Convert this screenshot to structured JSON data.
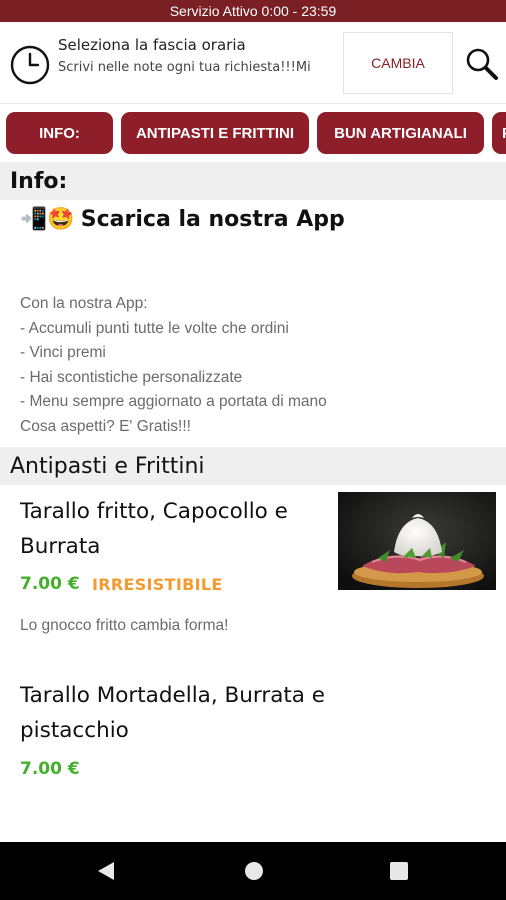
{
  "status_bar": {
    "text": "Servizio Attivo  0:00 - 23:59"
  },
  "timeslot": {
    "title": "Seleziona la fascia oraria",
    "subtitle": "Scrivi nelle note ogni tua richiesta!!!Mi",
    "change_label": "CAMBIA"
  },
  "tabs": [
    {
      "label": "INFO:"
    },
    {
      "label": "ANTIPASTI E FRITTINI"
    },
    {
      "label": "BUN  ARTIGIANALI"
    },
    {
      "label": "P"
    }
  ],
  "info": {
    "header": "Info:",
    "app_title": "Scarica la nostra App",
    "app_emojis": "📲🤩",
    "desc_lines": [
      "Con la nostra App:",
      "- Accumuli punti tutte le volte che ordini",
      "- Vinci premi",
      "- Hai scontistiche personalizzate",
      "- Menu sempre aggiornato a portata di mano",
      "Cosa aspetti? E' Gratis!!!"
    ]
  },
  "antipasti": {
    "header": "Antipasti e Frittini",
    "products": [
      {
        "title_line1": "Tarallo fritto, Capocollo e",
        "title_line2": "Burrata",
        "price": "7.00 €",
        "tag": "IRRESISTIBILE",
        "description": "Lo gnocco fritto cambia forma!"
      },
      {
        "title_line1": "Tarallo Mortadella, Burrata e",
        "title_line2": "pistacchio",
        "price": "7.00 €"
      }
    ]
  },
  "colors": {
    "brand": "#8e1f2a",
    "status_bar": "#7a1f24",
    "price": "#43b02a",
    "tag": "#f29b30"
  },
  "icons": {
    "clock": "clock-icon",
    "search": "search-icon",
    "back": "back-triangle-icon",
    "home": "home-circle-icon",
    "recents": "recents-square-icon"
  }
}
